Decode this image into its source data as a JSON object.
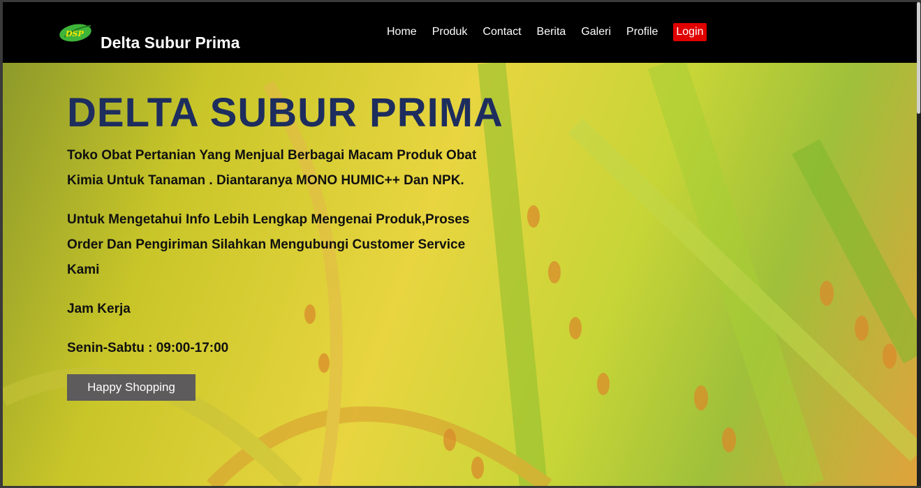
{
  "brand": {
    "logo_text": "DSP",
    "name": "Delta Subur Prima"
  },
  "nav": {
    "home": "Home",
    "produk": "Produk",
    "contact": "Contact",
    "berita": "Berita",
    "galeri": "Galeri",
    "profile": "Profile",
    "login": "Login"
  },
  "hero": {
    "title": "DELTA SUBUR PRIMA",
    "p1": "Toko Obat Pertanian Yang Menjual Berbagai Macam Produk Obat Kimia Untuk Tanaman . Diantaranya MONO HUMIC++ Dan NPK.",
    "p2": "Untuk Mengetahui Info Lebih Lengkap Mengenai Produk,Proses Order Dan Pengiriman Silahkan Mengubungi Customer Service Kami",
    "p3": "Jam Kerja",
    "p4": "Senin-Sabtu : 09:00-17:00",
    "button": "Happy Shopping"
  },
  "colors": {
    "nav_bg": "#000000",
    "login_bg": "#e00000",
    "title": "#1d2d5e",
    "button_bg": "#5d5b5b"
  },
  "icons": {
    "logo": "leaf-logo-icon"
  }
}
